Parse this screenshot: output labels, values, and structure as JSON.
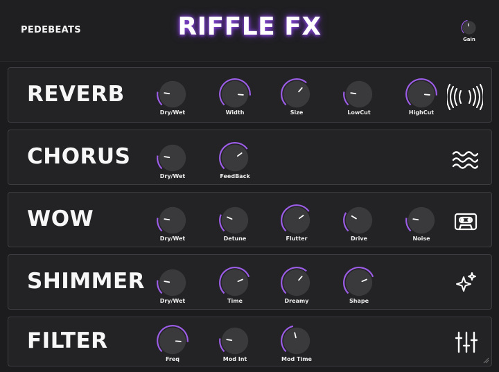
{
  "brand": "PEDEBEATS",
  "title": "RIFFLE FX",
  "gain": {
    "label": "Gain",
    "value": 0.45
  },
  "colors": {
    "accent": "#9b5de5",
    "knob": "#3a3a3d",
    "panel": "#232325",
    "border": "#3e3e42"
  },
  "panels": [
    {
      "name": "REVERB",
      "icon": "reverb-waves-icon",
      "knobs": [
        {
          "label": "Dry/Wet",
          "value": 0.2
        },
        {
          "label": "Width",
          "value": 0.85
        },
        {
          "label": "Size",
          "value": 0.65
        },
        {
          "label": "LowCut",
          "value": 0.2
        },
        {
          "label": "HighCut",
          "value": 0.85
        }
      ]
    },
    {
      "name": "CHORUS",
      "icon": "water-waves-icon",
      "knobs": [
        {
          "label": "Dry/Wet",
          "value": 0.2
        },
        {
          "label": "FeedBack",
          "value": 0.7
        }
      ]
    },
    {
      "name": "WOW",
      "icon": "cassette-icon",
      "knobs": [
        {
          "label": "Dry/Wet",
          "value": 0.2
        },
        {
          "label": "Detune",
          "value": 0.25
        },
        {
          "label": "Flutter",
          "value": 0.7
        },
        {
          "label": "Drive",
          "value": 0.28
        },
        {
          "label": "Noise",
          "value": 0.2
        }
      ]
    },
    {
      "name": "SHIMMER",
      "icon": "sparkle-icon",
      "knobs": [
        {
          "label": "Dry/Wet",
          "value": 0.2
        },
        {
          "label": "Time",
          "value": 0.75
        },
        {
          "label": "Dreamy",
          "value": 0.65
        },
        {
          "label": "Shape",
          "value": 0.75
        }
      ]
    },
    {
      "name": "FILTER",
      "icon": "sliders-icon",
      "knobs": [
        {
          "label": "Freq",
          "value": 0.85
        },
        {
          "label": "Mod Int",
          "value": 0.2
        },
        {
          "label": "Mod Time",
          "value": 0.45
        }
      ]
    }
  ]
}
